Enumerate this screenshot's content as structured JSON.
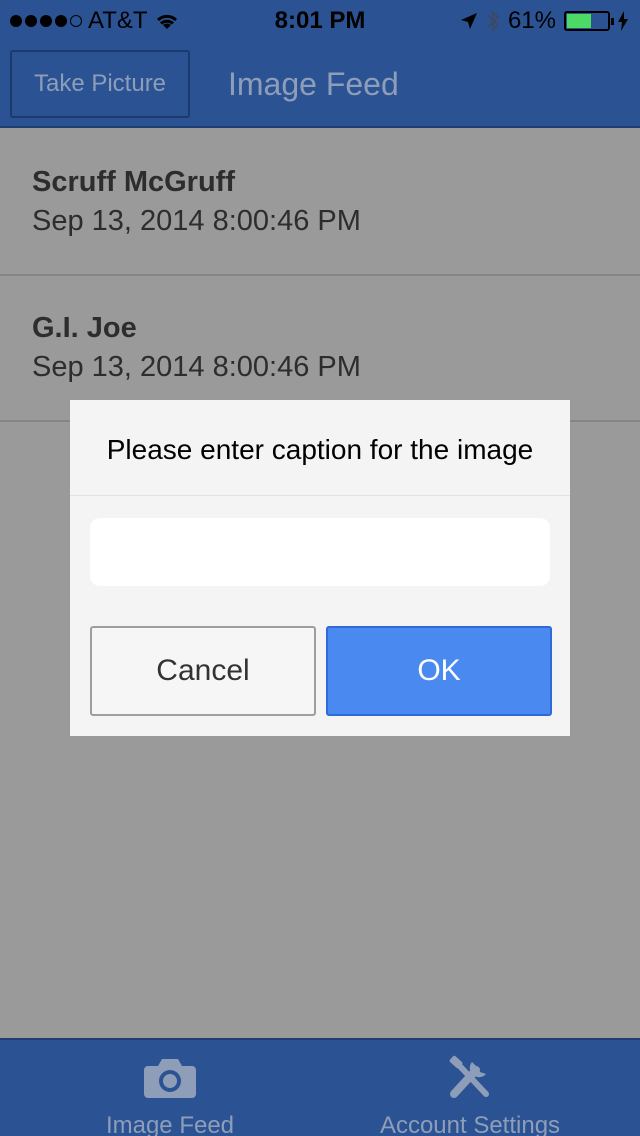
{
  "status_bar": {
    "carrier": "AT&T",
    "time": "8:01 PM",
    "battery_percent": "61%",
    "battery_level": 0.61,
    "signal_bars_filled": 4,
    "signal_bars_total": 5
  },
  "nav_bar": {
    "take_picture_label": "Take Picture",
    "title": "Image Feed"
  },
  "feed": {
    "items": [
      {
        "name": "Scruff McGruff",
        "date": "Sep 13, 2014 8:00:46 PM"
      },
      {
        "name": "G.I. Joe",
        "date": "Sep 13, 2014 8:00:46 PM"
      }
    ]
  },
  "dialog": {
    "title": "Please enter caption for the image",
    "input_value": "",
    "cancel_label": "Cancel",
    "ok_label": "OK"
  },
  "tab_bar": {
    "tabs": [
      {
        "label": "Image Feed",
        "icon": "camera-icon"
      },
      {
        "label": "Account Settings",
        "icon": "tools-icon"
      }
    ]
  },
  "colors": {
    "bar_blue": "#2b5394",
    "ok_blue": "#4a8af0",
    "battery_green": "#4cd964"
  }
}
